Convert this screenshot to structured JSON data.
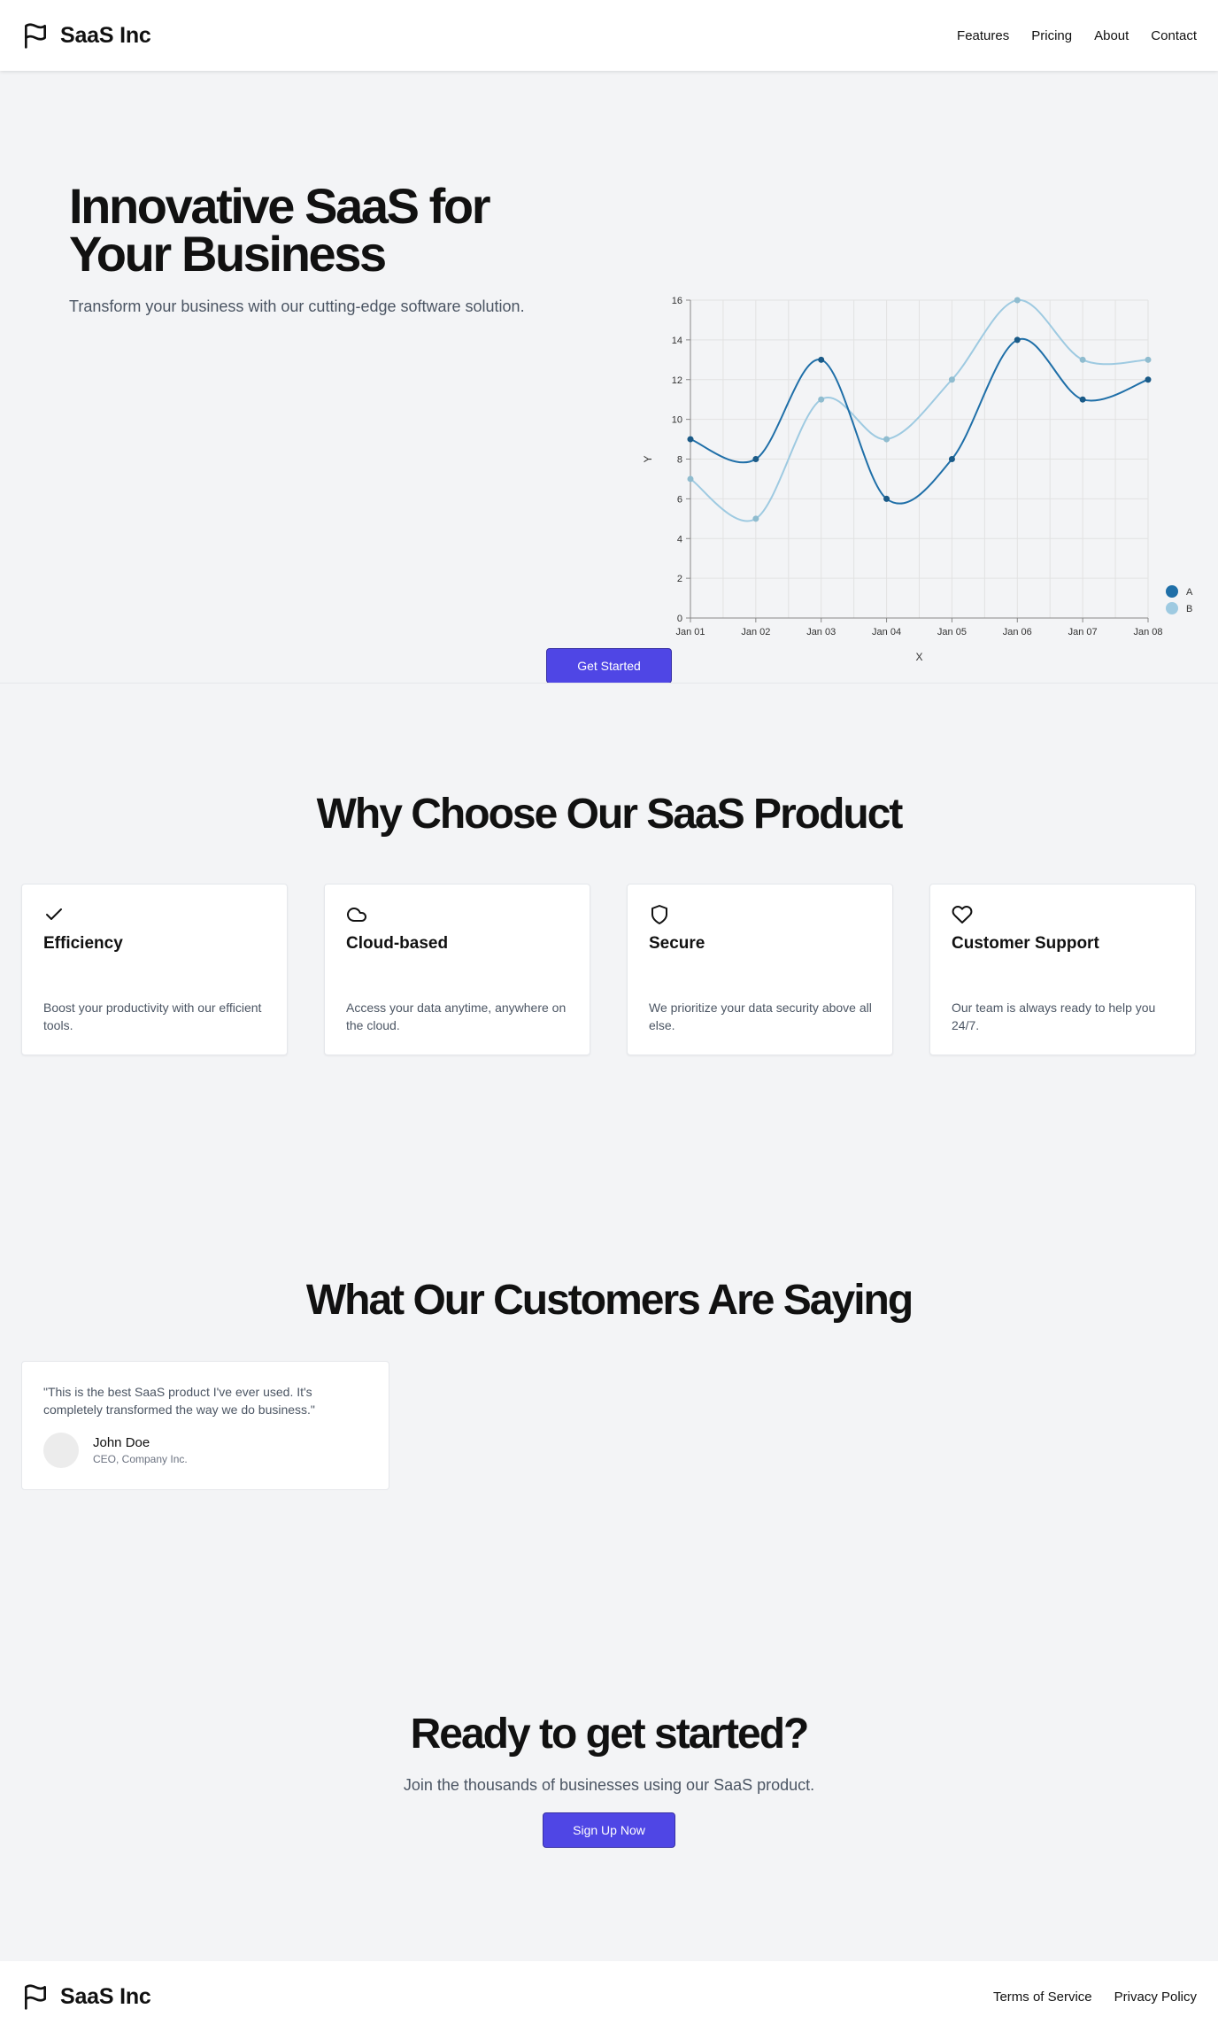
{
  "header": {
    "brand": "SaaS Inc",
    "nav": [
      "Features",
      "Pricing",
      "About",
      "Contact"
    ]
  },
  "hero": {
    "title": "Innovative SaaS for Your Business",
    "subtitle": "Transform your business with our cutting-edge software solution.",
    "cta_label": "Get Started"
  },
  "features": {
    "title": "Why Choose Our SaaS Product",
    "items": [
      {
        "icon": "check-icon",
        "title": "Efficiency",
        "desc": "Boost your productivity with our efficient tools."
      },
      {
        "icon": "cloud-icon",
        "title": "Cloud-based",
        "desc": "Access your data anytime, anywhere on the cloud."
      },
      {
        "icon": "shield-icon",
        "title": "Secure",
        "desc": "We prioritize your data security above all else."
      },
      {
        "icon": "heart-icon",
        "title": "Customer Support",
        "desc": "Our team is always ready to help you 24/7."
      }
    ]
  },
  "testimonials": {
    "title": "What Our Customers Are Saying",
    "items": [
      {
        "quote": "\"This is the best SaaS product I've ever used. It's completely transformed the way we do business.\"",
        "name": "John Doe",
        "role": "CEO, Company Inc."
      }
    ]
  },
  "cta": {
    "title": "Ready to get started?",
    "subtitle": "Join the thousands of businesses using our SaaS product.",
    "button_label": "Sign Up Now"
  },
  "footer": {
    "brand": "SaaS Inc",
    "links": [
      "Terms of Service",
      "Privacy Policy"
    ]
  },
  "colors": {
    "accent": "#4f46e5",
    "series_a": "#1f6fa8",
    "series_b": "#9ecae1"
  },
  "chart_data": {
    "type": "line",
    "categories": [
      "Jan 01",
      "Jan 02",
      "Jan 03",
      "Jan 04",
      "Jan 05",
      "Jan 06",
      "Jan 07",
      "Jan 08"
    ],
    "series": [
      {
        "name": "A",
        "values": [
          9,
          8,
          13,
          6,
          8,
          14,
          11,
          12
        ]
      },
      {
        "name": "B",
        "values": [
          7,
          5,
          11,
          9,
          12,
          16,
          13,
          13
        ]
      }
    ],
    "xlabel": "X",
    "ylabel": "Y",
    "ylim": [
      0,
      16
    ],
    "yticks": [
      0,
      2,
      4,
      6,
      8,
      10,
      12,
      14,
      16
    ],
    "grid": true,
    "legend": "bottom-right"
  }
}
